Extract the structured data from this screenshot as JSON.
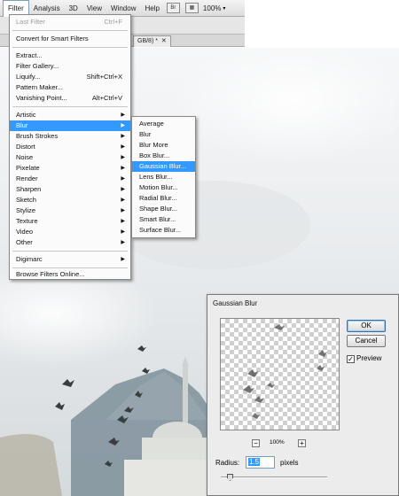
{
  "menubar": {
    "items": [
      "Filter",
      "Analysis",
      "3D",
      "View",
      "Window",
      "Help"
    ],
    "icon_box_1": "Br",
    "zoom": "100%"
  },
  "document_tab": {
    "label": "GB/8) *"
  },
  "filter_menu": {
    "last_filter": {
      "label": "Last Filter",
      "shortcut": "Ctrl+F"
    },
    "convert": "Convert for Smart Filters",
    "group_main": [
      {
        "label": "Extract...",
        "shortcut": ""
      },
      {
        "label": "Filter Gallery...",
        "shortcut": ""
      },
      {
        "label": "Liquify...",
        "shortcut": "Shift+Ctrl+X"
      },
      {
        "label": "Pattern Maker...",
        "shortcut": ""
      },
      {
        "label": "Vanishing Point...",
        "shortcut": "Alt+Ctrl+V"
      }
    ],
    "categories": [
      "Artistic",
      "Blur",
      "Brush Strokes",
      "Distort",
      "Noise",
      "Pixelate",
      "Render",
      "Sharpen",
      "Sketch",
      "Stylize",
      "Texture",
      "Video",
      "Other"
    ],
    "digimarc": "Digimarc",
    "browse": "Browse Filters Online..."
  },
  "blur_submenu": {
    "items": [
      "Average",
      "Blur",
      "Blur More",
      "Box Blur...",
      "Gaussian Blur...",
      "Lens Blur...",
      "Motion Blur...",
      "Radial Blur...",
      "Shape Blur...",
      "Smart Blur...",
      "Surface Blur..."
    ],
    "highlighted": "Gaussian Blur..."
  },
  "dialog": {
    "title": "Gaussian Blur",
    "ok": "OK",
    "cancel": "Cancel",
    "preview_label": "Preview",
    "preview_checked": true,
    "zoom_out": "−",
    "zoom_in": "+",
    "zoom_level": "100%",
    "radius_label": "Radius:",
    "radius_value": "1.5",
    "radius_unit": "pixels"
  },
  "colors": {
    "highlight": "#3399ff",
    "sky": "#dfe3e6",
    "mountain": "#7e8f9a"
  }
}
